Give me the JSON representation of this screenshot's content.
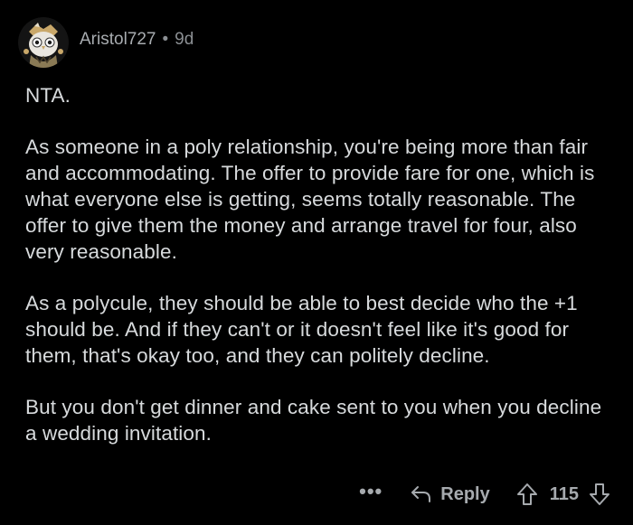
{
  "comment": {
    "username": "Aristol727",
    "separator": "•",
    "age": "9d",
    "paragraphs": [
      "NTA.",
      "As someone in a poly relationship, you're being more than fair and accommodating. The offer to provide fare for one, which is what everyone else is getting, seems totally reasonable. The offer to give them the money and arrange travel for four, also very reasonable.",
      "As a polycule, they should be able to best decide who the +1 should be. And if they can't or it doesn't feel like it's good for them, that's okay too, and they can politely decline.",
      "But you don't get dinner and cake sent to you when you decline a wedding invitation."
    ],
    "actions": {
      "more": "•••",
      "reply": "Reply",
      "vote_count": "115"
    }
  },
  "colors": {
    "background": "#000000",
    "text": "#d7dadc",
    "muted": "#8b8f93",
    "accent_avatar": "#c9a86a"
  },
  "icons": {
    "avatar": "owl-avatar",
    "reply": "reply-arrow-icon",
    "upvote": "upvote-arrow-icon",
    "downvote": "downvote-arrow-icon"
  }
}
